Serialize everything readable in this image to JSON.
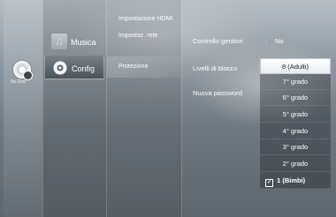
{
  "disc": {
    "label": "No Disc"
  },
  "menu": {
    "items": [
      {
        "label": "Musica",
        "icon": "music-icon"
      },
      {
        "label": "Config",
        "icon": "gear-icon",
        "selected": true
      }
    ]
  },
  "submenu": {
    "items": [
      {
        "label": "Impostazione HDMI"
      },
      {
        "label": "Impostaz. rete"
      },
      {
        "label": "Protezione",
        "selected": true
      }
    ]
  },
  "options": {
    "items": [
      {
        "label": "Controllo genitori",
        "separator": ":",
        "value": "No"
      },
      {
        "label": "Livelli di blocco"
      },
      {
        "label": "Nuova password"
      }
    ]
  },
  "dropdown": {
    "items": [
      {
        "label": "8 (Adulti)",
        "selected": true
      },
      {
        "label": "7° grado"
      },
      {
        "label": "6° grado"
      },
      {
        "label": "5° grado"
      },
      {
        "label": "4° grado"
      },
      {
        "label": "3° grado"
      },
      {
        "label": "2° grado"
      },
      {
        "label": "1 (Bimbi)",
        "checked": true,
        "check_icon": "checkbox-icon"
      }
    ]
  }
}
